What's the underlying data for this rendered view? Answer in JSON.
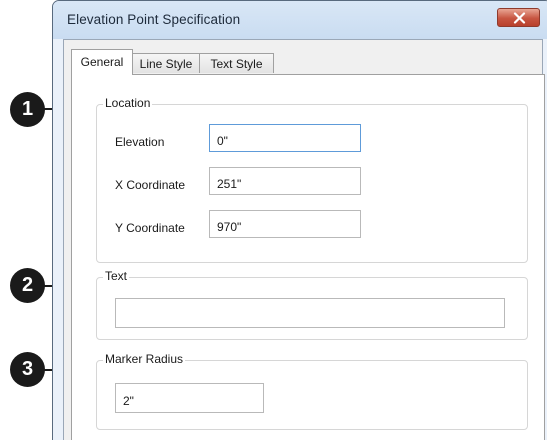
{
  "window": {
    "title": "Elevation Point Specification",
    "close_icon": "close-x-icon"
  },
  "tabs": [
    {
      "label": "General",
      "active": true
    },
    {
      "label": "Line Style",
      "active": false
    },
    {
      "label": "Text Style",
      "active": false
    }
  ],
  "location": {
    "group_title": "Location",
    "elevation_label": "Elevation",
    "elevation_value": "0\"",
    "x_label": "X Coordinate",
    "x_value": "251\"",
    "y_label": "Y Coordinate",
    "y_value": "970\""
  },
  "text_group": {
    "group_title": "Text",
    "value": ""
  },
  "marker": {
    "group_title": "Marker Radius",
    "value": "2\""
  },
  "callouts": [
    "1",
    "2",
    "3"
  ],
  "colors": {
    "close_button": "#c75541",
    "focus_border": "#5e9bd9",
    "callout": "#1a1a1a"
  }
}
